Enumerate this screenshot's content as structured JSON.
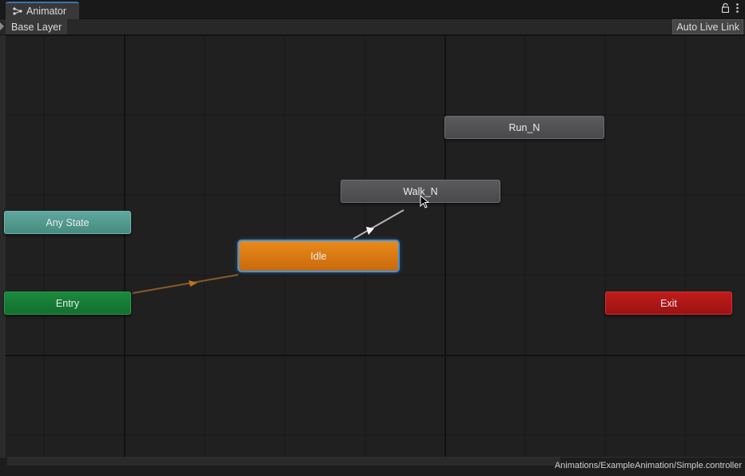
{
  "window": {
    "tab_label": "Animator",
    "tab_icon": "animator-graph-icon"
  },
  "toolbar": {
    "breadcrumb": "Base Layer",
    "auto_live_link_label": "Auto Live Link"
  },
  "graph": {
    "states": [
      {
        "id": "run",
        "label": "Run_N",
        "kind": "state"
      },
      {
        "id": "walk",
        "label": "Walk_N",
        "kind": "state"
      },
      {
        "id": "any",
        "label": "Any State",
        "kind": "any-state"
      },
      {
        "id": "idle",
        "label": "Idle",
        "kind": "default-state",
        "selected": true
      },
      {
        "id": "entry",
        "label": "Entry",
        "kind": "entry"
      },
      {
        "id": "exit",
        "label": "Exit",
        "kind": "exit"
      }
    ],
    "transitions": [
      {
        "from": "Entry",
        "to": "Idle"
      },
      {
        "from": "Idle",
        "to": "Walk_N"
      }
    ]
  },
  "status": {
    "controller_path": "Animations/ExampleAnimation/Simple.controller"
  },
  "colors": {
    "state": "#4f4f52",
    "any_state": "#509a8f",
    "entry": "#167d36",
    "exit": "#ad1616",
    "default_state": "#d97a13",
    "selection": "#3d93e0"
  }
}
